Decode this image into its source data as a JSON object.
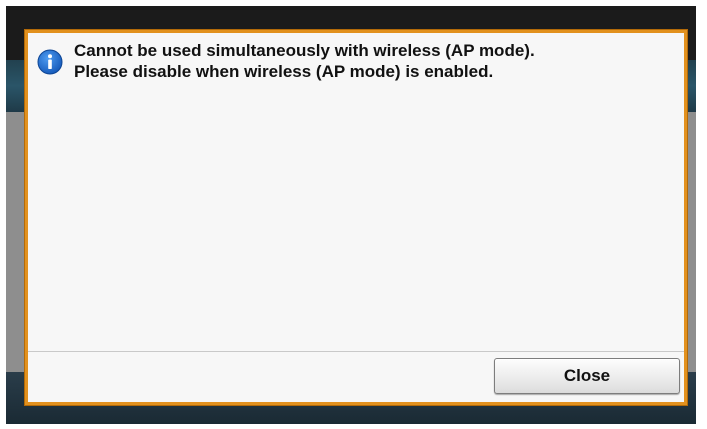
{
  "dialog": {
    "icon": "info-icon",
    "message_lines": [
      "Cannot be used simultaneously with wireless (AP mode).",
      "Please disable when wireless (AP mode) is enabled."
    ],
    "close_label": "Close"
  },
  "colors": {
    "dialog_border": "#e2911e",
    "dialog_background": "#f7f7f7",
    "icon_blue": "#1e6fd8",
    "header_band": "#2a5568",
    "backdrop_gray": "#8e8e8e"
  }
}
